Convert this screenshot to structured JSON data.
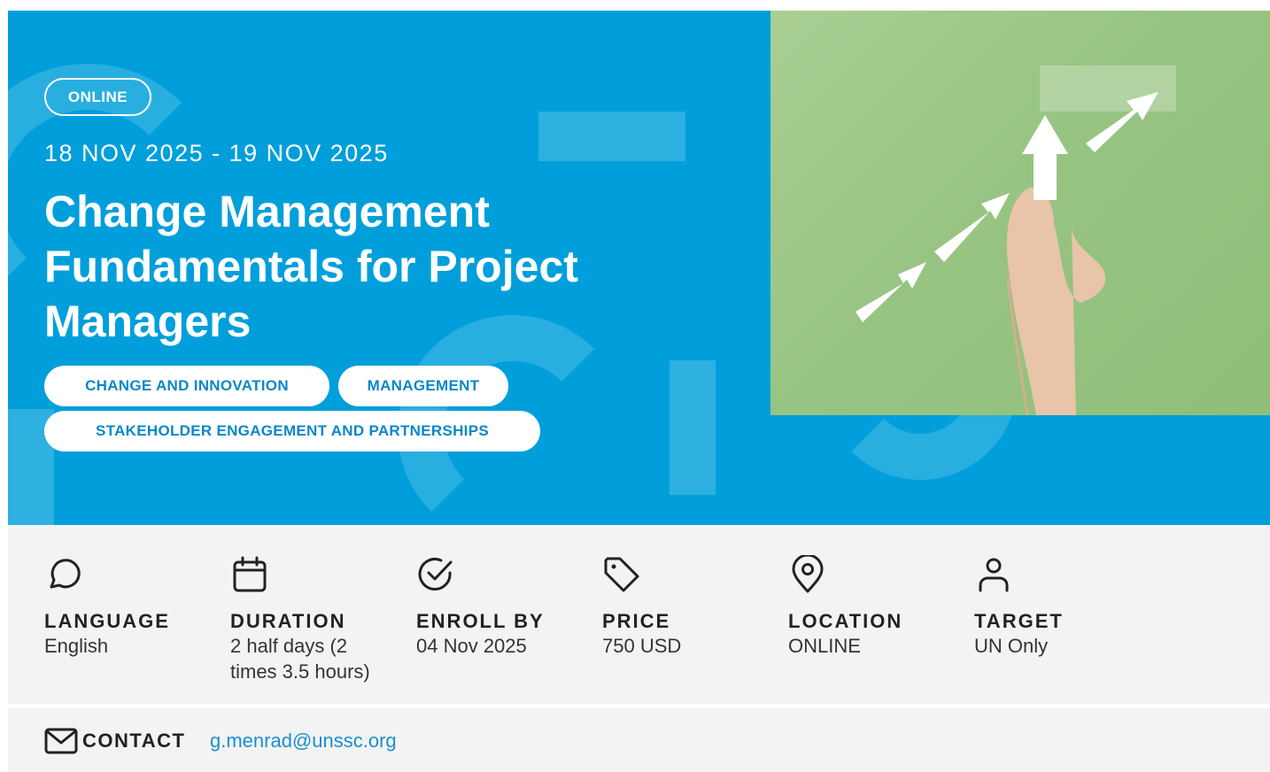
{
  "course": {
    "mode_badge": "ONLINE",
    "dates": "18 NOV 2025 - 19 NOV 2025",
    "title": "Change Management Fundamentals for Project Managers",
    "tags": [
      "CHANGE AND INNOVATION",
      "MANAGEMENT",
      "STAKEHOLDER ENGAGEMENT AND PARTNERSHIPS"
    ]
  },
  "info": [
    {
      "icon": "speech-bubble-icon",
      "label": "LANGUAGE",
      "value": "English"
    },
    {
      "icon": "calendar-icon",
      "label": "DURATION",
      "value": "2 half days (2 times 3.5 hours)"
    },
    {
      "icon": "check-circle-icon",
      "label": "ENROLL BY",
      "value": "04 Nov 2025"
    },
    {
      "icon": "price-tag-icon",
      "label": "PRICE",
      "value": "750 USD"
    },
    {
      "icon": "map-pin-icon",
      "label": "LOCATION",
      "value": "ONLINE"
    },
    {
      "icon": "user-icon",
      "label": "TARGET",
      "value": "UN Only"
    }
  ],
  "contact": {
    "icon": "envelope-icon",
    "label": "CONTACT",
    "email": "g.menrad@unssc.org"
  },
  "colors": {
    "hero_blue": "#009fdb",
    "tag_text": "#0a87c8",
    "link": "#1a8fd0",
    "panel_bg": "#f3f3f3"
  }
}
